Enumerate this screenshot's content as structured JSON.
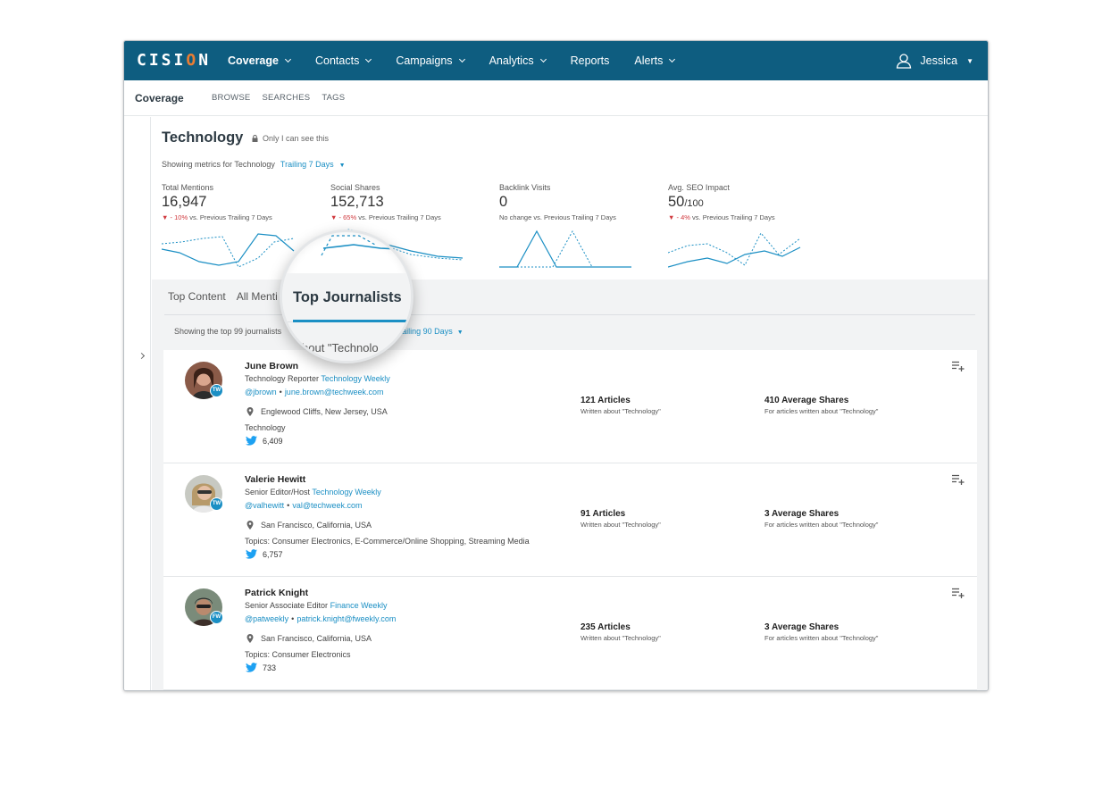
{
  "brand": {
    "name_pre": "CISI",
    "name_o": "O",
    "name_post": "N"
  },
  "nav": {
    "items": [
      {
        "label": "Coverage",
        "dropdown": true,
        "active": true
      },
      {
        "label": "Contacts",
        "dropdown": true
      },
      {
        "label": "Campaigns",
        "dropdown": true
      },
      {
        "label": "Analytics",
        "dropdown": true
      },
      {
        "label": "Reports",
        "dropdown": false
      },
      {
        "label": "Alerts",
        "dropdown": true
      }
    ],
    "user": "Jessica"
  },
  "subnav": {
    "title": "Coverage",
    "links": [
      "BROWSE",
      "SEARCHES",
      "TAGS"
    ]
  },
  "page": {
    "title": "Technology",
    "privacy": "Only I can see this",
    "showing": "Showing metrics for Technology",
    "range": "Trailing 7 Days"
  },
  "metrics": [
    {
      "label": "Total Mentions",
      "value": "16,947",
      "unit": "",
      "change_neg": "- 10%",
      "change_text": " vs. Previous Trailing 7 Days"
    },
    {
      "label": "Social Shares",
      "value": "152,713",
      "unit": "",
      "change_neg": "- 65%",
      "change_text": " vs. Previous Trailing 7 Days"
    },
    {
      "label": "Backlink Visits",
      "value": "0",
      "unit": "",
      "change_neg": "",
      "change_text": "No change vs. Previous Trailing 7 Days"
    },
    {
      "label": "Avg. SEO Impact",
      "value": "50",
      "unit": "/100",
      "change_neg": "- 4%",
      "change_text": " vs. Previous Trailing 7 Days"
    }
  ],
  "tabs": {
    "items": [
      "Top Content",
      "All Menti",
      "Top Journalists"
    ],
    "active": "Top Journalists"
  },
  "journalists_list": {
    "showing": "Showing the top 99 journalists",
    "magnified_text": "bout \"Technolo",
    "range": "Trailing 90 Days"
  },
  "journalists": [
    {
      "name": "June Brown",
      "role": "Technology Reporter",
      "outlet": "Technology Weekly",
      "handle": "@jbrown",
      "email": "june.brown@techweek.com",
      "location": "Englewood Cliffs, New Jersey, USA",
      "topics": "Technology",
      "followers": "6,409",
      "badge": "TW",
      "articles": "121 Articles",
      "articles_sub": "Written about \"Technology\"",
      "shares": "410 Average Shares",
      "shares_sub": "For articles written about \"Technology\""
    },
    {
      "name": "Valerie Hewitt",
      "role": "Senior Editor/Host",
      "outlet": "Technology Weekly",
      "handle": "@valhewitt",
      "email": "val@techweek.com",
      "location": "San Francisco, California, USA",
      "topics": "Topics: Consumer Electronics, E-Commerce/Online Shopping, Streaming Media",
      "followers": "6,757",
      "badge": "TW",
      "articles": "91 Articles",
      "articles_sub": "Written about \"Technology\"",
      "shares": "3 Average Shares",
      "shares_sub": "For articles written about \"Technology\""
    },
    {
      "name": "Patrick Knight",
      "role": "Senior Associate Editor",
      "outlet": "Finance Weekly",
      "handle": "@patweekly",
      "email": "patrick.knight@fweekly.com",
      "location": "San Francisco, California, USA",
      "topics": "Topics: Consumer Electronics",
      "followers": "733",
      "badge": "FW",
      "articles": "235 Articles",
      "articles_sub": "Written about \"Technology\"",
      "shares": "3 Average Shares",
      "shares_sub": "For articles written about \"Technology\""
    }
  ],
  "icons": {
    "nav_dropdown": "chevron-down-icon",
    "user": "user-icon",
    "privacy": "lock-icon",
    "expand": "chevron-right-icon",
    "location": "map-pin-icon",
    "twitter": "twitter-icon",
    "add_to_list": "add-to-list-icon"
  },
  "colors": {
    "nav_bg": "#0e5d80",
    "accent": "#1b8fc4",
    "negative": "#d0393e",
    "brand_accent": "#e97d33"
  }
}
